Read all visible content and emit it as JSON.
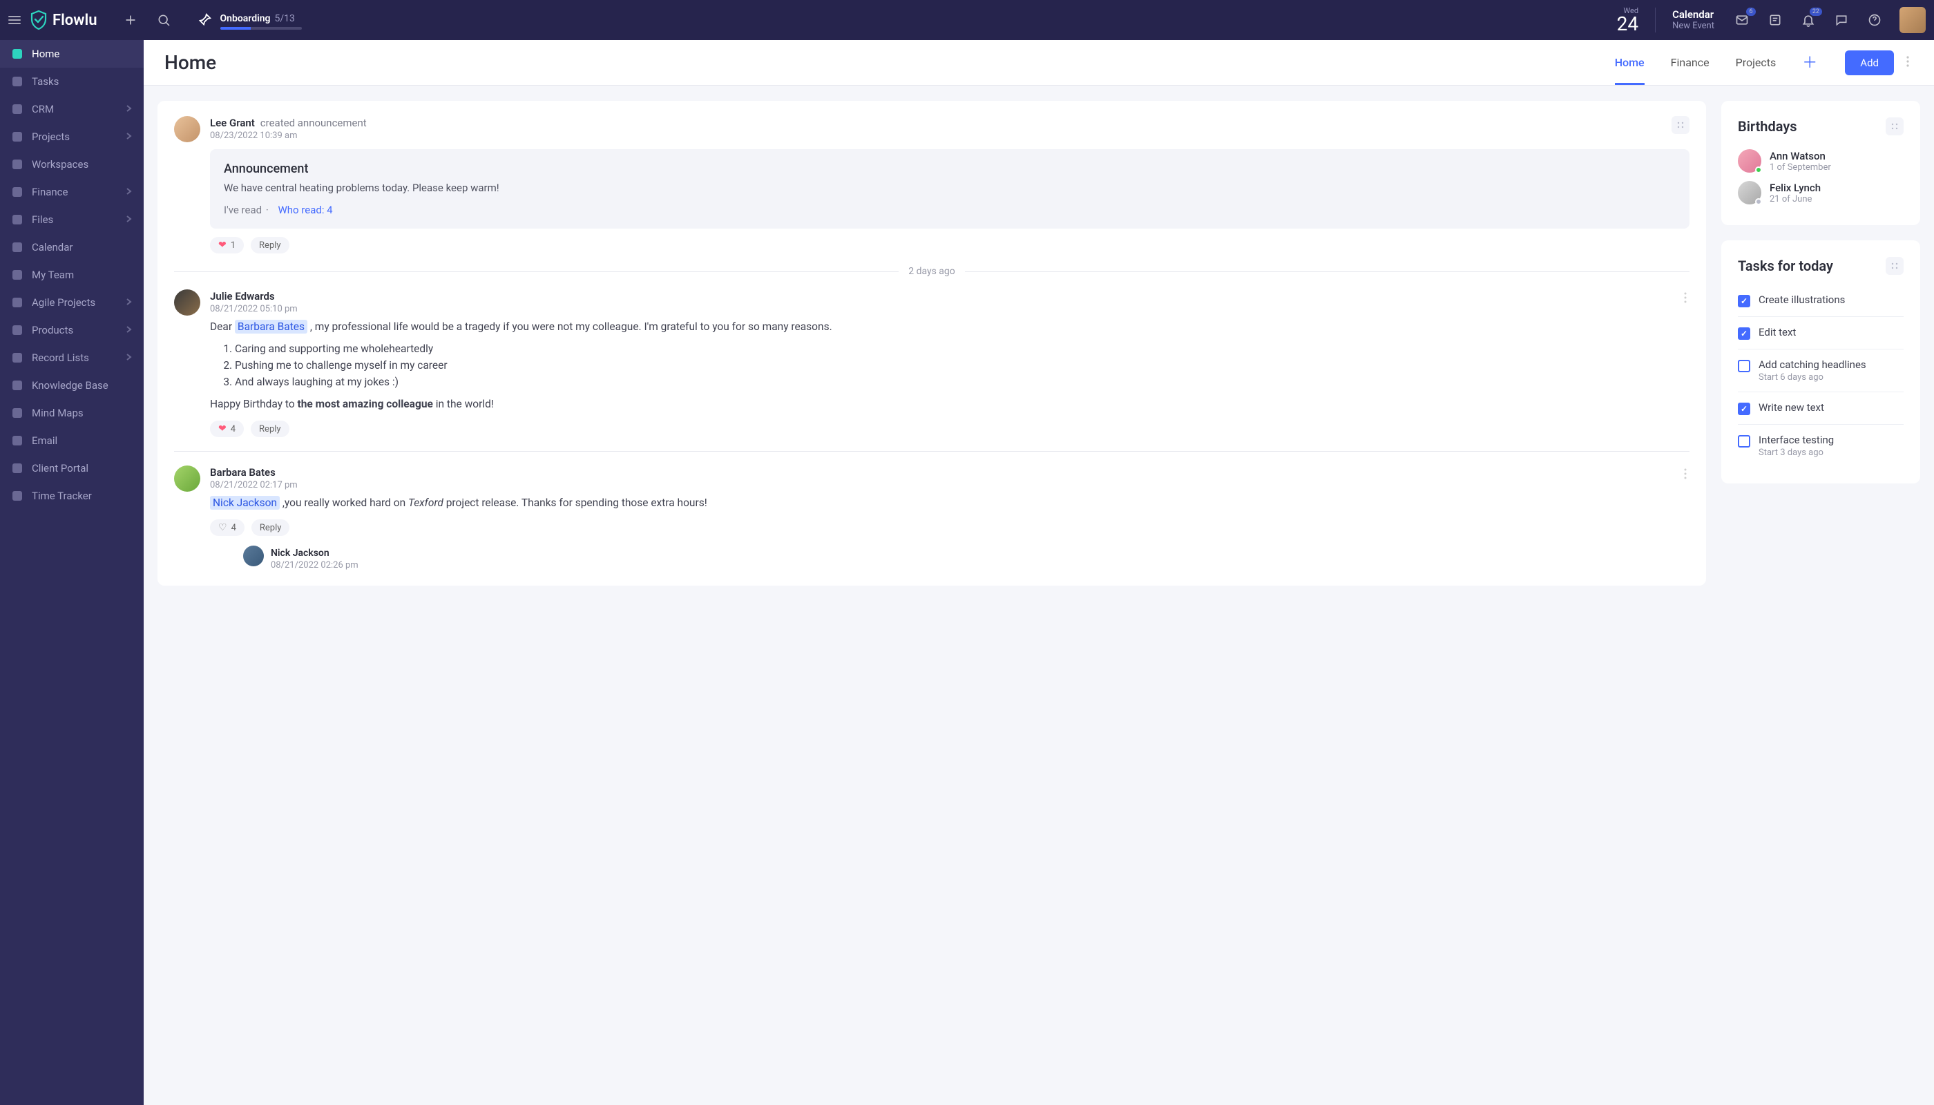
{
  "brand": "Flowlu",
  "onboarding": {
    "label": "Onboarding",
    "count": "5/13"
  },
  "date": {
    "dow": "Wed",
    "num": "24"
  },
  "calendar": {
    "label": "Calendar",
    "sub": "New Event"
  },
  "badges": {
    "inbox": "6",
    "bell": "22"
  },
  "nav": [
    {
      "label": "Home",
      "active": true,
      "chevron": false
    },
    {
      "label": "Tasks",
      "chevron": false
    },
    {
      "label": "CRM",
      "chevron": true
    },
    {
      "label": "Projects",
      "chevron": true
    },
    {
      "label": "Workspaces",
      "chevron": false
    },
    {
      "label": "Finance",
      "chevron": true
    },
    {
      "label": "Files",
      "chevron": true
    },
    {
      "label": "Calendar",
      "chevron": false
    },
    {
      "label": "My Team",
      "chevron": false
    },
    {
      "label": "Agile Projects",
      "chevron": true
    },
    {
      "label": "Products",
      "chevron": true
    },
    {
      "label": "Record Lists",
      "chevron": true
    },
    {
      "label": "Knowledge Base",
      "chevron": false
    },
    {
      "label": "Mind Maps",
      "chevron": false
    },
    {
      "label": "Email",
      "chevron": false
    },
    {
      "label": "Client Portal",
      "chevron": false
    },
    {
      "label": "Time Tracker",
      "chevron": false
    }
  ],
  "page": {
    "title": "Home"
  },
  "tabs": [
    {
      "label": "Home",
      "active": true
    },
    {
      "label": "Finance"
    },
    {
      "label": "Projects"
    }
  ],
  "add_button": "Add",
  "feed": {
    "divider_2days": "2 days ago",
    "post1": {
      "author": "Lee Grant",
      "action": "created announcement",
      "time": "08/23/2022 10:39 am",
      "announce_title": "Announcement",
      "announce_body": "We have central heating problems today. Please keep warm!",
      "ive_read": "I've read",
      "who_read": "Who read: 4",
      "like_count": "1",
      "reply_label": "Reply"
    },
    "post2": {
      "author": "Julie Edwards",
      "time": "08/21/2022 05:10 pm",
      "dear": "Dear ",
      "mention": "Barbara Bates",
      "body_after": " , my professional life would be a tragedy if you were not my colleague. I'm grateful to you for so many reasons.",
      "li1": "Caring and supporting me wholeheartedly",
      "li2": "Pushing me to challenge myself in my career",
      "li3": "And always laughing at my jokes :)",
      "closing_pre": "Happy Birthday to ",
      "closing_bold": "the most amazing colleague",
      "closing_post": " in the world!",
      "like_count": "4",
      "reply_label": "Reply"
    },
    "post3": {
      "author": "Barbara Bates",
      "time": "08/21/2022 02:17 pm",
      "mention": "Nick Jackson",
      "body_pre": " ,you really worked hard on ",
      "body_em": "Texford",
      "body_post": " project release. Thanks for spending those extra hours!",
      "like_count": "4",
      "reply_label": "Reply",
      "reply1_author": "Nick Jackson",
      "reply1_time": "08/21/2022 02:26 pm"
    }
  },
  "birthdays": {
    "title": "Birthdays",
    "items": [
      {
        "name": "Ann Watson",
        "date": "1 of September",
        "presence": "#3ccf4e"
      },
      {
        "name": "Felix Lynch",
        "date": "21 of June",
        "presence": "#b9bccb"
      }
    ]
  },
  "tasks_widget": {
    "title": "Tasks for today",
    "items": [
      {
        "label": "Create illustrations",
        "checked": true
      },
      {
        "label": "Edit text",
        "checked": true
      },
      {
        "label": "Add catching headlines",
        "sub": "Start 6 days ago",
        "checked": false
      },
      {
        "label": "Write new text",
        "checked": true
      },
      {
        "label": "Interface testing",
        "sub": "Start 3 days ago",
        "checked": false
      }
    ]
  }
}
